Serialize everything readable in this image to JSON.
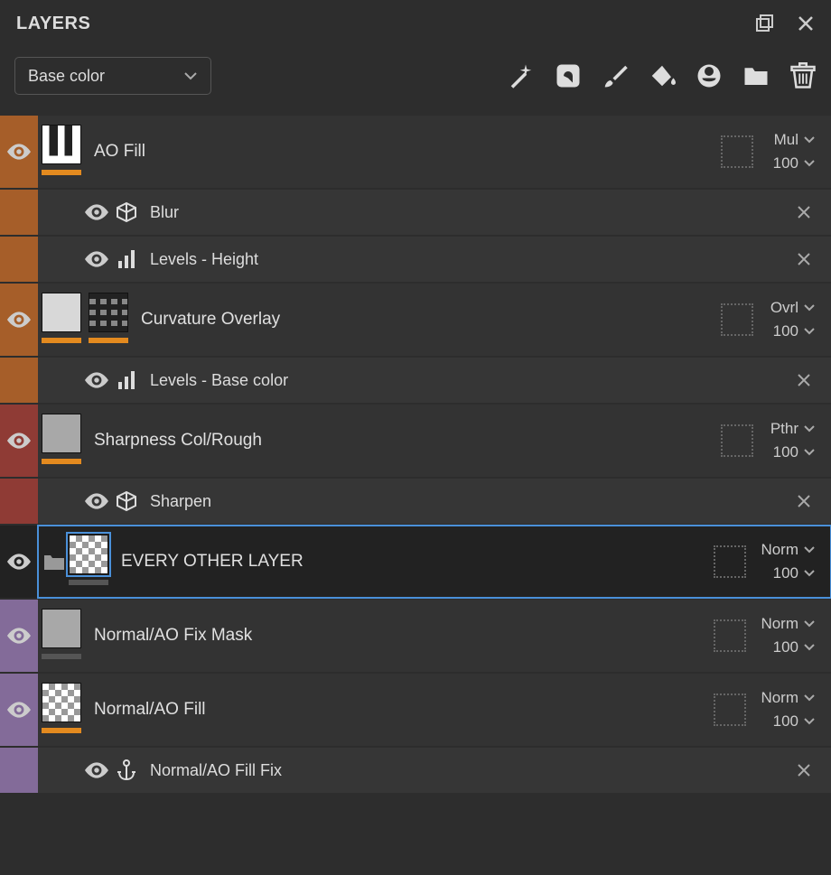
{
  "panel_title": "LAYERS",
  "channel_selector": "Base color",
  "toolbar_icons": [
    "magic-wand",
    "effects",
    "brush",
    "fill-bucket",
    "smart-material",
    "folder",
    "trash"
  ],
  "layers": [
    {
      "id": "ao-fill",
      "color": "orange",
      "name": "AO Fill",
      "blend": "Mul",
      "opacity": "100",
      "thumbs": [
        {
          "type": "ao",
          "bar": "orange"
        }
      ]
    },
    {
      "id": "blur",
      "sub": true,
      "parent_color": "orange",
      "icon": "cube",
      "name": "Blur"
    },
    {
      "id": "levels-height",
      "sub": true,
      "parent_color": "orange",
      "icon": "bars",
      "name": "Levels - Height"
    },
    {
      "id": "curvature-overlay",
      "color": "orange",
      "name": "Curvature Overlay",
      "blend": "Ovrl",
      "opacity": "100",
      "thumbs": [
        {
          "type": "grayl",
          "bar": "orange"
        },
        {
          "type": "blocks",
          "bar": "orange"
        }
      ]
    },
    {
      "id": "levels-basecolor",
      "sub": true,
      "parent_color": "orange",
      "icon": "bars",
      "name": "Levels - Base color"
    },
    {
      "id": "sharpness",
      "color": "red",
      "name": "Sharpness Col/Rough",
      "blend": "Pthr",
      "opacity": "100",
      "thumbs": [
        {
          "type": "gray",
          "bar": "orange"
        }
      ]
    },
    {
      "id": "sharpen",
      "sub": true,
      "parent_color": "red",
      "icon": "cube",
      "name": "Sharpen"
    },
    {
      "id": "every-other",
      "selected": true,
      "folder": true,
      "name": "EVERY OTHER LAYER",
      "blend": "Norm",
      "opacity": "100",
      "thumbs": [
        {
          "type": "checker",
          "bar": "gray",
          "sel": true
        }
      ]
    },
    {
      "id": "normal-ao-fix-mask",
      "color": "purple",
      "name": "Normal/AO Fix Mask",
      "blend": "Norm",
      "opacity": "100",
      "thumbs": [
        {
          "type": "gray",
          "bar": "gray"
        }
      ]
    },
    {
      "id": "normal-ao-fill",
      "color": "purple",
      "name": "Normal/AO Fill",
      "blend": "Norm",
      "opacity": "100",
      "thumbs": [
        {
          "type": "checker",
          "bar": "orange"
        }
      ]
    },
    {
      "id": "normal-ao-fill-fix",
      "sub": true,
      "parent_color": "purple",
      "icon": "anchor",
      "name": "Normal/AO Fill Fix"
    }
  ]
}
